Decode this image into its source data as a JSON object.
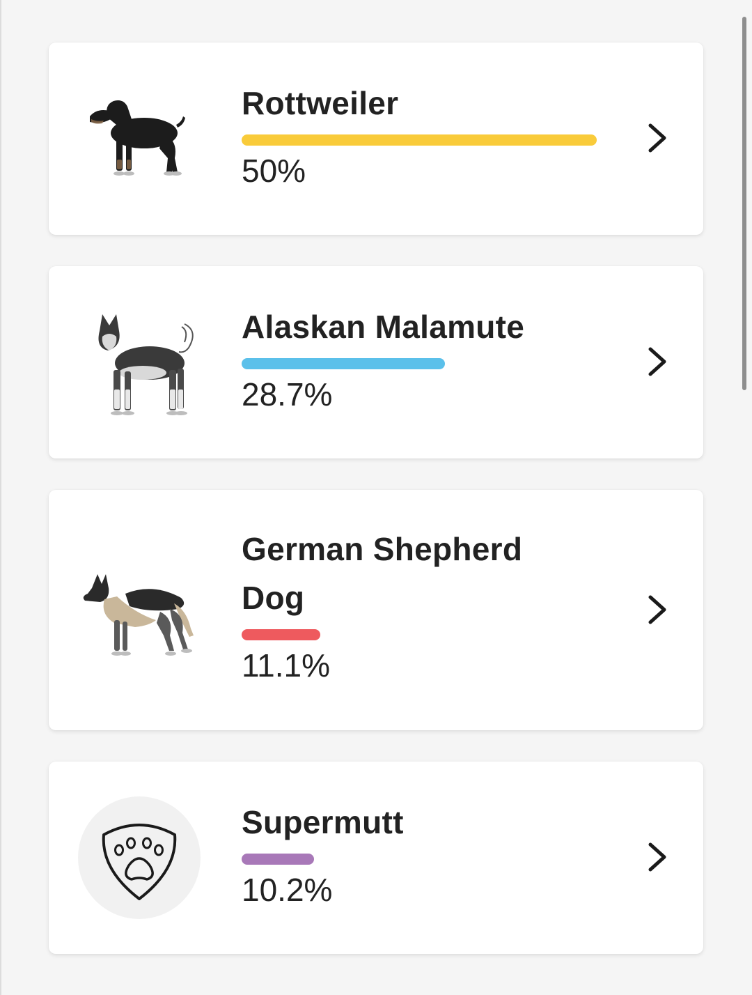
{
  "breeds": [
    {
      "name": "Rottweiler",
      "percent_label": "50%",
      "percent": 50,
      "color": "#F9CB3A",
      "image_icon": "rottweiler-illustration"
    },
    {
      "name": "Alaskan Malamute",
      "percent_label": "28.7%",
      "percent": 28.7,
      "color": "#5BC0EA",
      "image_icon": "alaskan-malamute-illustration"
    },
    {
      "name": "German Shepherd Dog",
      "percent_label": "11.1%",
      "percent": 11.1,
      "color": "#EE5A5E",
      "image_icon": "german-shepherd-illustration"
    },
    {
      "name": "Supermutt",
      "percent_label": "10.2%",
      "percent": 10.2,
      "color": "#A878B8",
      "image_icon": "paw-shield-icon"
    }
  ],
  "chevron_icon": "chevron-right-icon"
}
